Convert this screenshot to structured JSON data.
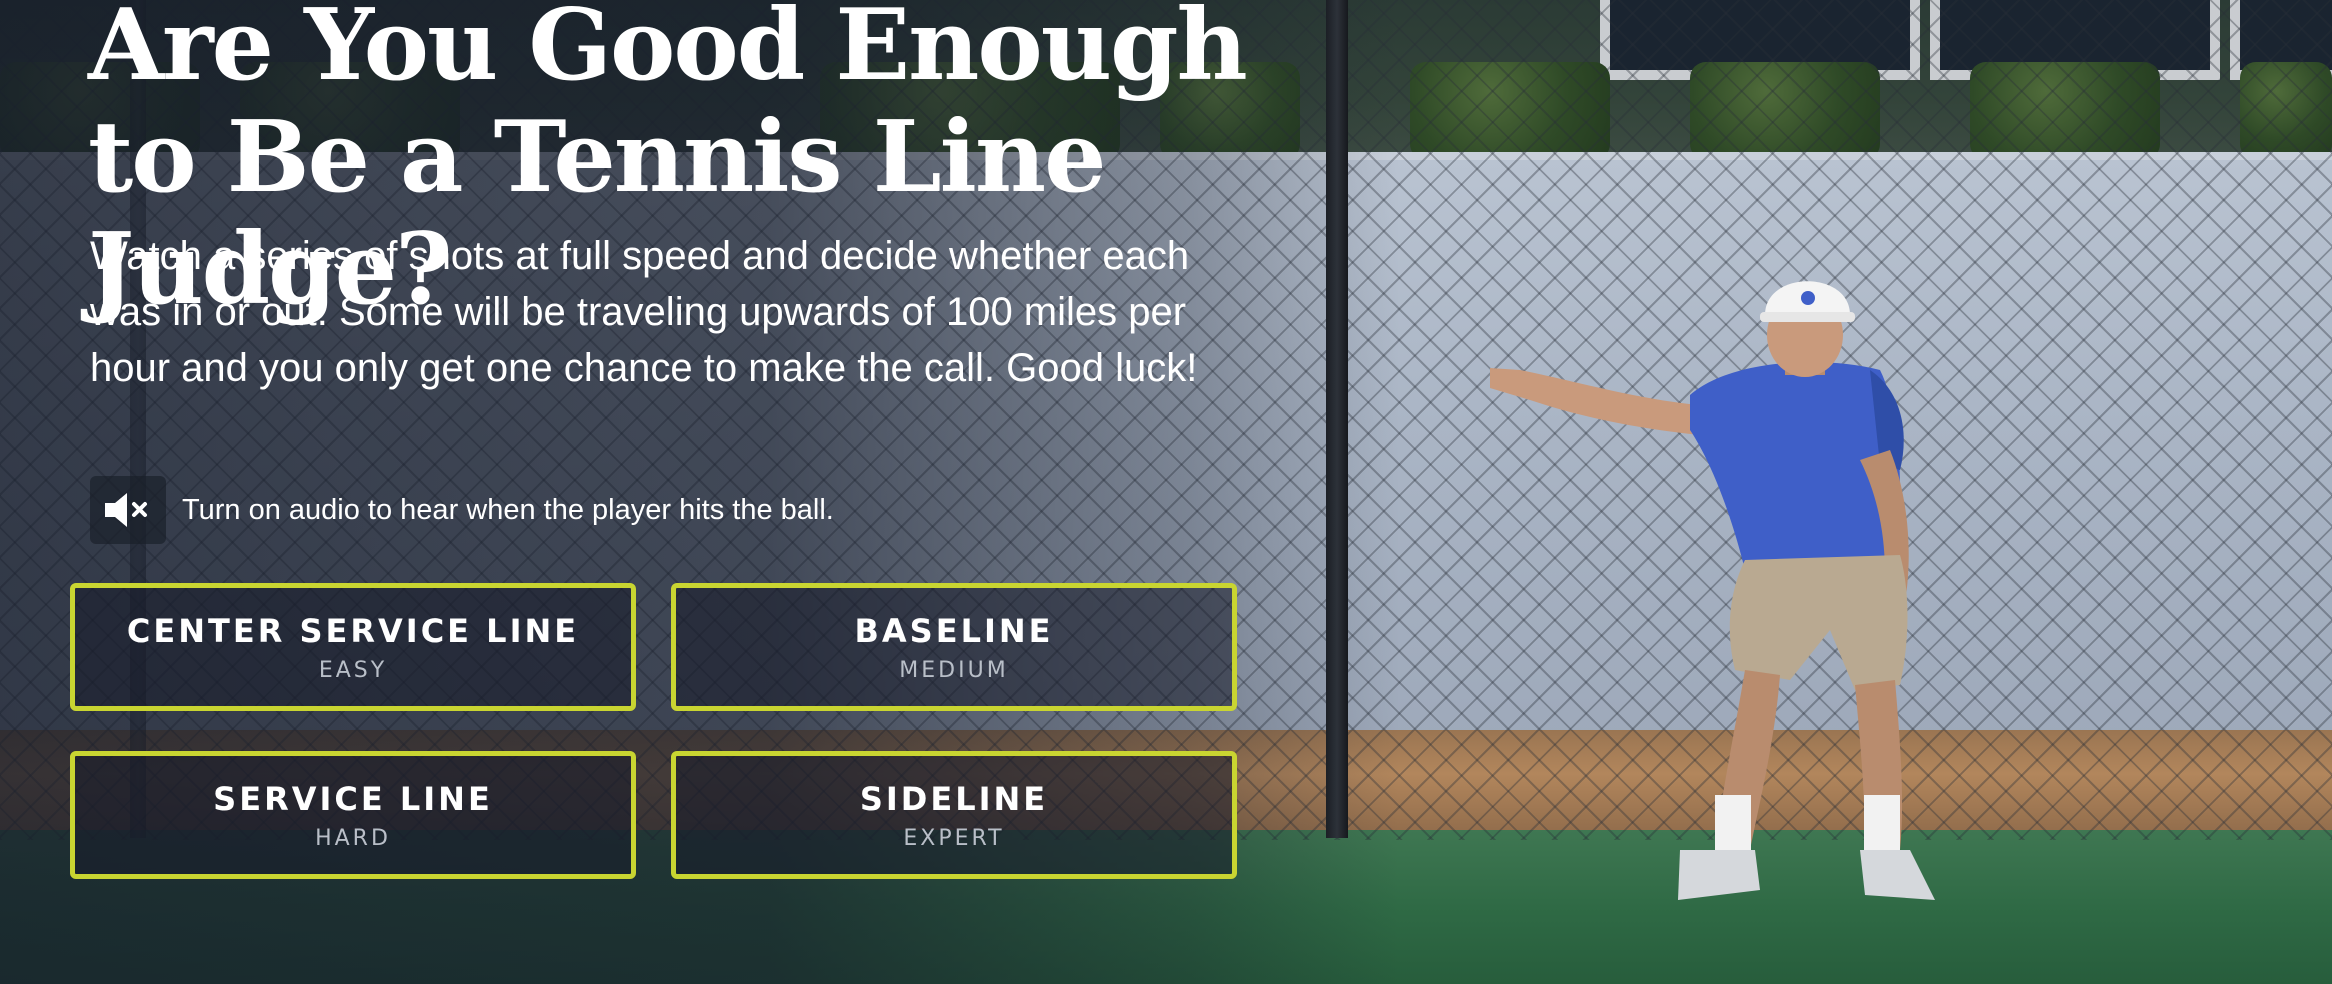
{
  "headline": "Are You Good Enough to Be a Tennis Line Judge?",
  "intro": "Watch a series of shots at full speed and decide whether each was in or out. Some will be traveling upwards of 100 miles per hour and you only get one chance to make the call. Good luck!",
  "audio": {
    "icon": "speaker-muted-icon",
    "text": "Turn on audio to hear when the player hits the ball."
  },
  "levels": [
    {
      "name": "CENTER SERVICE LINE",
      "difficulty": "EASY"
    },
    {
      "name": "BASELINE",
      "difficulty": "MEDIUM"
    },
    {
      "name": "SERVICE LINE",
      "difficulty": "HARD"
    },
    {
      "name": "SIDELINE",
      "difficulty": "EXPERT"
    }
  ],
  "colors": {
    "accent_border": "#c9d531",
    "text": "#ffffff",
    "subtext": "#b9bfc8"
  }
}
